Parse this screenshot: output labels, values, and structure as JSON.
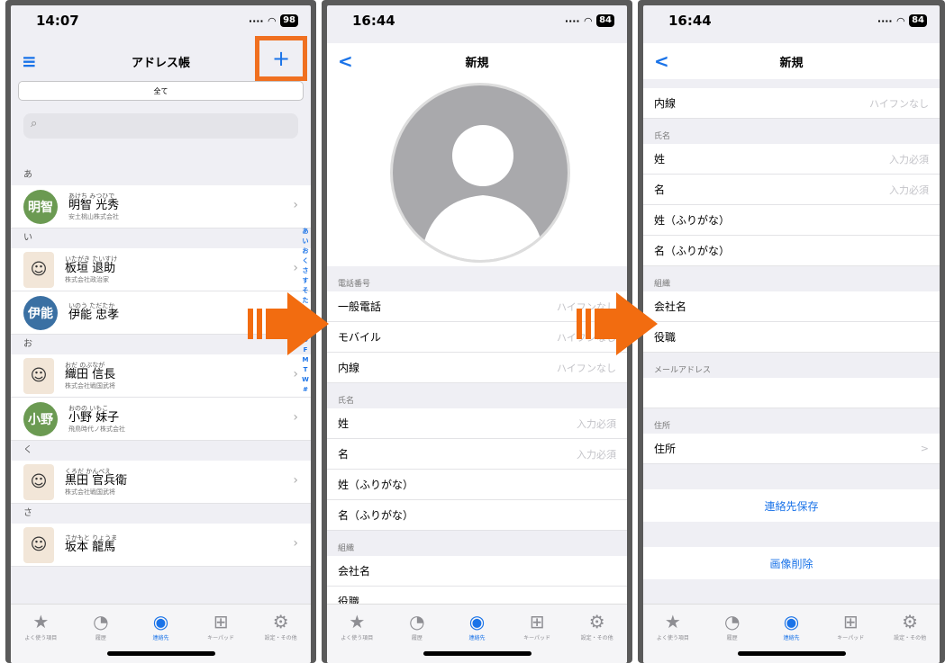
{
  "phone1": {
    "time": "14:07",
    "battery": "98",
    "title": "アドレス帳",
    "add": "+",
    "menu": "≡",
    "segment": "全て",
    "search_icon": "⌕",
    "sections": [
      {
        "header": "あ",
        "rows": [
          {
            "avatar": "明智",
            "avatar_color": "#6b9a52",
            "kana": "あけち みつひで",
            "name": "明智 光秀",
            "company": "安土桃山株式会社"
          }
        ]
      },
      {
        "header": "い",
        "rows": [
          {
            "avatar": "☺",
            "image": true,
            "kana": "いたがき たいすけ",
            "name": "板垣 退助",
            "company": "株式会社政治家"
          },
          {
            "avatar": "伊能",
            "avatar_color": "#3a70a3",
            "kana": "いのう ただたか",
            "name": "伊能 忠孝",
            "company": ""
          }
        ]
      },
      {
        "header": "お",
        "rows": [
          {
            "avatar": "☺",
            "image": true,
            "kana": "おだ のぶなが",
            "name": "織田 信長",
            "company": "株式会社戦国武将"
          },
          {
            "avatar": "小野",
            "avatar_color": "#6b9a52",
            "kana": "おのの いもこ",
            "name": "小野 妹子",
            "company": "飛鳥時代ノ株式会社"
          }
        ]
      },
      {
        "header": "く",
        "rows": [
          {
            "avatar": "☺",
            "image": true,
            "kana": "くろだ かんべえ",
            "name": "黒田 官兵衛",
            "company": "株式会社戦国武将"
          }
        ]
      },
      {
        "header": "さ",
        "rows": [
          {
            "avatar": "☺",
            "image": true,
            "kana": "さかもと りょうま",
            "name": "坂本 龍馬",
            "company": ""
          }
        ]
      }
    ],
    "index": [
      "あ",
      "い",
      "お",
      "く",
      "さ",
      "す",
      "そ",
      "た",
      "ひ",
      "B",
      "C",
      "D",
      "F",
      "M",
      "T",
      "W",
      "#"
    ]
  },
  "phone2": {
    "time": "16:44",
    "battery": "84",
    "title": "新規",
    "back": "<",
    "sections": [
      {
        "header": "電話番号",
        "rows": [
          {
            "label": "一般電話",
            "ph": "ハイフンなし"
          },
          {
            "label": "モバイル",
            "ph": "ハイフンなし"
          },
          {
            "label": "内線",
            "ph": "ハイフンなし"
          }
        ]
      },
      {
        "header": "氏名",
        "rows": [
          {
            "label": "姓",
            "ph": "入力必須"
          },
          {
            "label": "名",
            "ph": "入力必須"
          },
          {
            "label": "姓（ふりがな）",
            "ph": ""
          },
          {
            "label": "名（ふりがな）",
            "ph": ""
          }
        ]
      },
      {
        "header": "組織",
        "rows": [
          {
            "label": "会社名",
            "ph": ""
          },
          {
            "label": "役職",
            "ph": ""
          }
        ]
      }
    ]
  },
  "phone3": {
    "time": "16:44",
    "battery": "84",
    "title": "新規",
    "back": "<",
    "top_row": {
      "label": "内線",
      "ph": "ハイフンなし"
    },
    "sections": [
      {
        "header": "氏名",
        "rows": [
          {
            "label": "姓",
            "ph": "入力必須"
          },
          {
            "label": "名",
            "ph": "入力必須"
          },
          {
            "label": "姓（ふりがな）",
            "ph": ""
          },
          {
            "label": "名（ふりがな）",
            "ph": ""
          }
        ]
      },
      {
        "header": "組織",
        "rows": [
          {
            "label": "会社名",
            "ph": ""
          },
          {
            "label": "役職",
            "ph": ""
          }
        ]
      },
      {
        "header": "メールアドレス",
        "rows": [
          {
            "label": "",
            "ph": ""
          }
        ]
      },
      {
        "header": "住所",
        "rows": [
          {
            "label": "住所",
            "ph": "",
            "chev": ">"
          }
        ]
      }
    ],
    "save": "連絡先保存",
    "delete": "画像削除"
  },
  "tabbar": [
    {
      "icon": "★",
      "label": "よく使う項目"
    },
    {
      "icon": "◔",
      "label": "履歴"
    },
    {
      "icon": "◉",
      "label": "連絡先",
      "active": true
    },
    {
      "icon": "⊞",
      "label": "キーパッド"
    },
    {
      "icon": "⚙",
      "label": "設定・その他"
    }
  ],
  "colors": {
    "accent": "#1a73e8",
    "arrow": "#f26c10"
  }
}
